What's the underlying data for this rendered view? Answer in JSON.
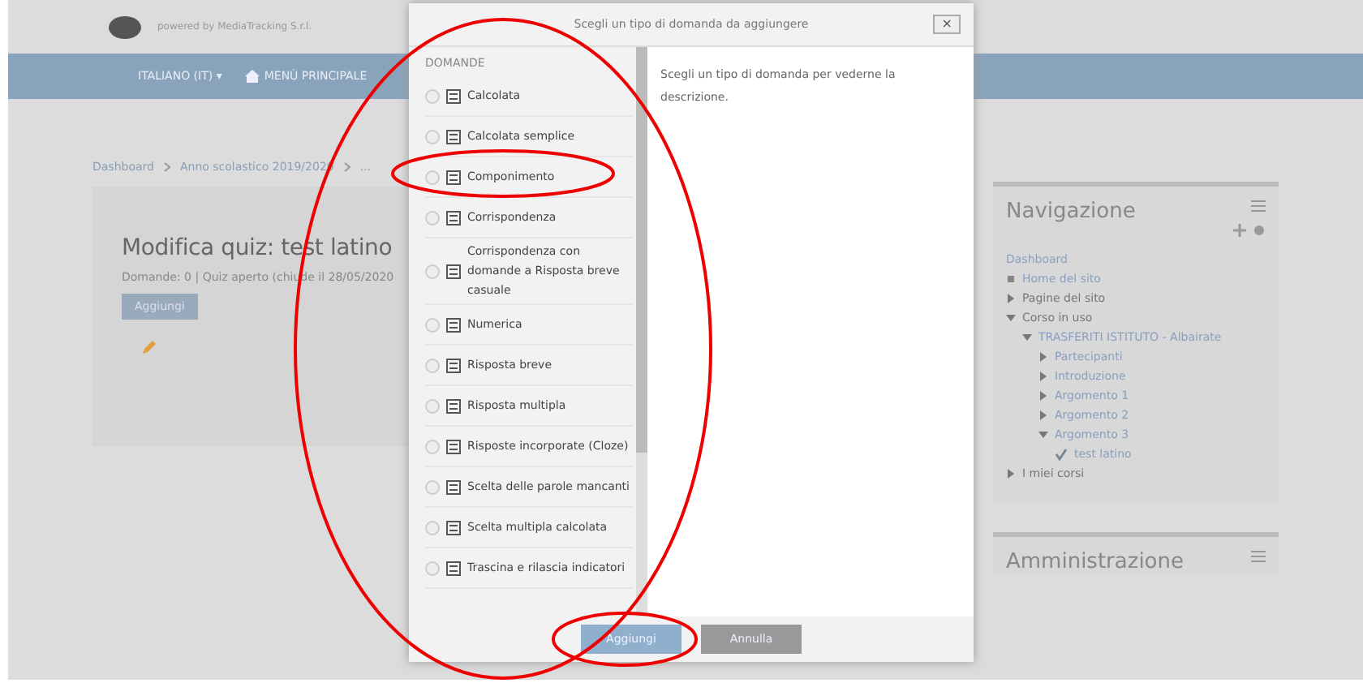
{
  "header": {
    "tagline": "powered by MediaTracking S.r.l."
  },
  "navbar": {
    "items": [
      {
        "label": "ITALIANO (IT) ▾",
        "kind": "dropdown"
      },
      {
        "label": "MENÙ PRINCIPALE",
        "kind": "home"
      }
    ]
  },
  "breadcrumb": [
    "Dashboard",
    "Anno scolastico 2019/2020",
    "..."
  ],
  "quiz": {
    "title": "Modifica quiz: test latino",
    "info": "Domande: 0 | Quiz aperto (chiude il 28/05/2020",
    "add_button": "Aggiungi"
  },
  "dialog": {
    "title": "Scegli un tipo di domanda da aggiungere",
    "close": "×",
    "section": "DOMANDE",
    "question_types": [
      {
        "label": "Calcolata",
        "selected": false
      },
      {
        "label": "Calcolata semplice",
        "selected": false
      },
      {
        "label": "Componimento",
        "selected": false
      },
      {
        "label": "Corrispondenza",
        "selected": false
      },
      {
        "label": "Corrispondenza con domande a Risposta breve casuale",
        "selected": false
      },
      {
        "label": "Numerica",
        "selected": false
      },
      {
        "label": "Risposta breve",
        "selected": false
      },
      {
        "label": "Risposta multipla",
        "selected": false
      },
      {
        "label": "Risposte incorporate (Cloze)",
        "selected": false
      },
      {
        "label": "Scelta delle parole mancanti",
        "selected": false
      },
      {
        "label": "Scelta multipla calcolata",
        "selected": false
      },
      {
        "label": "Trascina e rilascia indicatori",
        "selected": false
      }
    ],
    "description": "Scegli un tipo di domanda per vederne la descrizione.",
    "buttons": [
      {
        "label": "Aggiungi",
        "kind": "primary"
      },
      {
        "label": "Annulla",
        "kind": "secondary"
      }
    ]
  },
  "navigation": {
    "title": "Navigazione",
    "tree": [
      {
        "label": "Dashboard",
        "kind": "link"
      },
      {
        "label": "Home del sito",
        "kind": "home"
      },
      {
        "label": "Pagine del sito",
        "kind": "branch",
        "expanded": false
      },
      {
        "label": "Corso in uso",
        "kind": "branch",
        "expanded": true,
        "children": [
          {
            "label": "TRASFERITI ISTITUTO - Albairate",
            "kind": "branch",
            "expanded": true,
            "children": [
              {
                "label": "Partecipanti",
                "kind": "branch",
                "expanded": false
              },
              {
                "label": "Introduzione",
                "kind": "branch",
                "expanded": false
              },
              {
                "label": "Argomento 1",
                "kind": "branch",
                "expanded": false
              },
              {
                "label": "Argomento 2",
                "kind": "branch",
                "expanded": false
              },
              {
                "label": "Argomento 3",
                "kind": "branch",
                "expanded": true,
                "children": [
                  {
                    "label": "test latino",
                    "kind": "quiz"
                  }
                ]
              }
            ]
          }
        ]
      },
      {
        "label": "I miei corsi",
        "kind": "branch",
        "expanded": false
      }
    ]
  },
  "administration": {
    "title": "Amministrazione"
  }
}
